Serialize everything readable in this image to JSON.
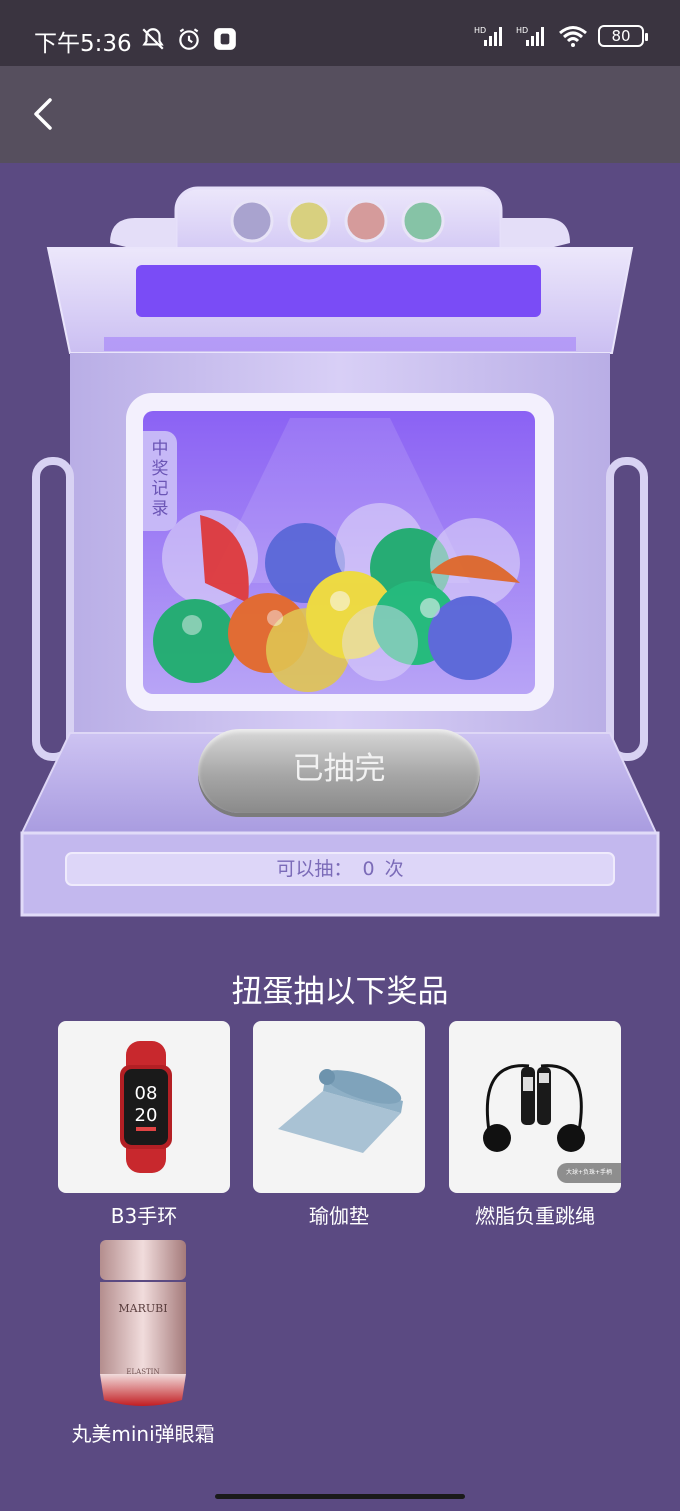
{
  "status_bar": {
    "time": "下午5:36",
    "battery": "80",
    "icons": [
      "mute-icon",
      "alarm-icon",
      "app-icon",
      "hd-signal-icon",
      "hd-signal-icon",
      "wifi-icon",
      "battery-icon"
    ]
  },
  "nav": {
    "back_icon": "chevron-left-icon"
  },
  "machine": {
    "records_tab": "中奖记录",
    "draw_button": "已抽完",
    "remaining_label": "可以抽：",
    "remaining_count": "0",
    "remaining_unit": "次"
  },
  "prizes": {
    "title": "扭蛋抽以下奖品",
    "items": [
      {
        "name": "B3手环",
        "watch_hour": "08",
        "watch_min": "20"
      },
      {
        "name": "瑜伽垫"
      },
      {
        "name": "燃脂负重跳绳",
        "badge": "大球+负珠+手柄"
      },
      {
        "name": "丸美mini弹眼霜",
        "brand": "MARUBI",
        "product": "ELASTIN"
      }
    ]
  },
  "colors": {
    "page_bg": "#5b4a82",
    "status_bg": "#3a3440",
    "nav_bg": "#564f5e",
    "machine_body": "#c9bdf0",
    "screen_purple": "#7a4cf6",
    "button_gray": "#a8a8a8"
  }
}
